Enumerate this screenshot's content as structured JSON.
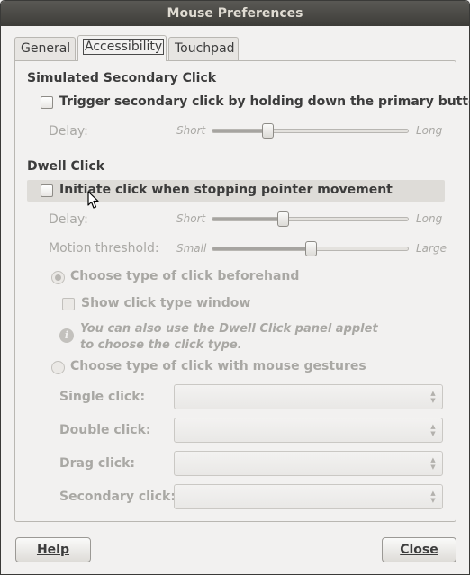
{
  "window": {
    "title": "Mouse Preferences"
  },
  "tabs": [
    {
      "label": "General",
      "active": false
    },
    {
      "label": "Accessibility",
      "active": true
    },
    {
      "label": "Touchpad",
      "active": false
    }
  ],
  "secondary_click": {
    "heading": "Simulated Secondary Click",
    "checkbox_label": "Trigger secondary click by holding down the primary button",
    "checked": false,
    "delay": {
      "label": "Delay:",
      "min_label": "Short",
      "max_label": "Long",
      "value": 0.28
    }
  },
  "dwell_click": {
    "heading": "Dwell Click",
    "checkbox_label": "Initiate click when stopping pointer movement",
    "checked": false,
    "delay": {
      "label": "Delay:",
      "min_label": "Short",
      "max_label": "Long",
      "value": 0.36
    },
    "motion": {
      "label": "Motion threshold:",
      "min_label": "Small",
      "max_label": "Large",
      "value": 0.5
    },
    "choose_beforehand": {
      "label": "Choose type of click beforehand",
      "selected": true,
      "show_window_label": "Show click type window",
      "info_line1": "You can also use the Dwell Click panel applet",
      "info_line2": "to choose the click type."
    },
    "choose_gestures": {
      "label": "Choose type of click with mouse gestures",
      "selected": false,
      "single": "Single click:",
      "double": "Double click:",
      "drag": "Drag click:",
      "secondary": "Secondary click:"
    }
  },
  "buttons": {
    "help": "Help",
    "close": "Close"
  },
  "icons": {
    "info": "info-icon",
    "pointer": "mouse-pointer-icon"
  },
  "colors": {
    "titlebar": "#3d3c38",
    "window_bg": "#f2f1f0",
    "disabled_text": "#a9a8a4"
  }
}
